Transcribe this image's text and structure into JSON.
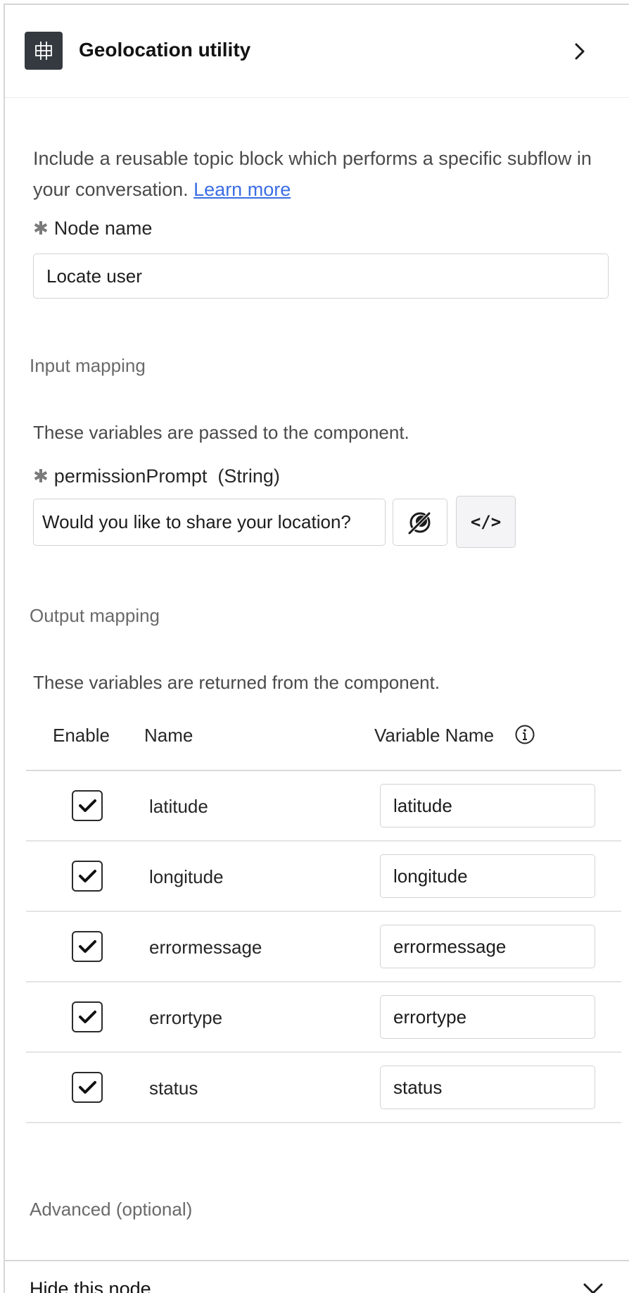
{
  "header": {
    "title": "Geolocation utility",
    "icon": "grid-icon",
    "action_icon": "chevron-right-icon"
  },
  "description": {
    "text": "Include a reusable topic block which performs a specific subflow in your conversation.",
    "link": "Learn more"
  },
  "node_name": {
    "required_marker": "✱",
    "label": "Node name",
    "value": "Locate user"
  },
  "input_mapping": {
    "title": "Input mapping",
    "helper": "These variables are passed to the component.",
    "field": {
      "required_marker": "✱",
      "name": "permissionPrompt",
      "type": "(String)",
      "value": "Would you like to share your location?"
    },
    "buttons": [
      {
        "icon": "target-icon"
      },
      {
        "icon": "code-icon",
        "glyph": "</>"
      }
    ]
  },
  "output_mapping": {
    "title": "Output mapping",
    "helper": "These variables are returned from the component.",
    "columns": {
      "enable": "Enable",
      "name": "Name",
      "variable_name": "Variable Name"
    },
    "info_icon": "info-icon",
    "rows": [
      {
        "enabled": true,
        "name": "latitude",
        "variable": "latitude"
      },
      {
        "enabled": true,
        "name": "longitude",
        "variable": "longitude"
      },
      {
        "enabled": true,
        "name": "errormessage",
        "variable": "errormessage"
      },
      {
        "enabled": true,
        "name": "errortype",
        "variable": "errortype"
      },
      {
        "enabled": true,
        "name": "status",
        "variable": "status"
      }
    ]
  },
  "advanced": {
    "title": "Advanced (optional)"
  },
  "footer": {
    "title": "Hide this node",
    "icon": "chevron-down-icon"
  },
  "colors": {
    "link": "#3b6ee3",
    "header_icon_bg": "#343a40"
  }
}
